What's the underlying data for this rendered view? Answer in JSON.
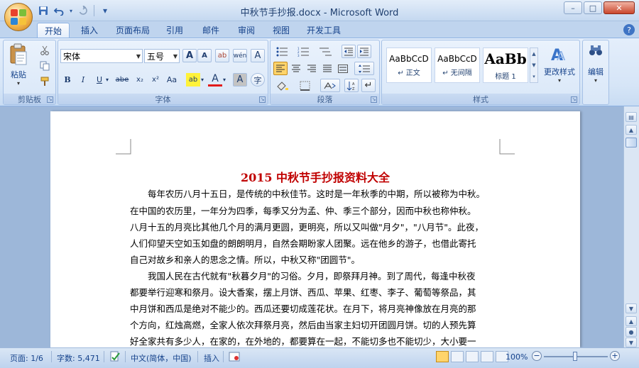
{
  "window": {
    "title": "中秋节手抄报.docx - Microsoft Word",
    "controls": {
      "minimize": "–",
      "maximize": "□",
      "close": "✕"
    }
  },
  "quick_access": {
    "save_icon": "save-icon",
    "undo_icon": "undo-icon",
    "redo_icon": "redo-icon",
    "customize": "▾"
  },
  "tabs": [
    {
      "label": "开始",
      "active": true
    },
    {
      "label": "插入"
    },
    {
      "label": "页面布局"
    },
    {
      "label": "引用"
    },
    {
      "label": "邮件"
    },
    {
      "label": "审阅"
    },
    {
      "label": "视图"
    },
    {
      "label": "开发工具"
    }
  ],
  "ribbon": {
    "clipboard": {
      "label": "剪贴板",
      "paste_label": "粘贴"
    },
    "font": {
      "label": "字体",
      "font_name": "宋体",
      "font_size": "五号",
      "bold": "B",
      "italic": "I",
      "underline": "U",
      "strikethrough": "abe",
      "subscript": "x₂",
      "superscript": "x²",
      "change_case": "Aa",
      "grow": "A",
      "shrink": "A",
      "clear": "ab",
      "phonetic": "wén",
      "border": "A",
      "highlight": "ab",
      "font_color": "A",
      "shading": "A",
      "enclosed": "字"
    },
    "paragraph": {
      "label": "段落"
    },
    "styles": {
      "label": "样式",
      "items": [
        {
          "sample": "AaBbCcD",
          "name": "↵ 正文"
        },
        {
          "sample": "AaBbCcD",
          "name": "↵ 无间隔"
        },
        {
          "sample": "AaBb",
          "name": "标题 1"
        }
      ],
      "change_styles": "更改样式"
    },
    "editing": {
      "label": "编辑"
    }
  },
  "document": {
    "title": "2015 中秋节手抄报资料大全",
    "lines": [
      "每年农历八月十五日，是传统的中秋佳节。这时是一年秋季的中期，所以被称为中秋。",
      "在中国的农历里，一年分为四季，每季又分为孟、仲、季三个部分，因而中秋也称仲秋。",
      "八月十五的月亮比其他几个月的满月更圆，更明亮，所以又叫做\"月夕\"，\"八月节\"。此夜，",
      "人们仰望天空如玉如盘的朗朗明月，自然会期盼家人团聚。远在他乡的游子，也借此寄托",
      "自己对故乡和亲人的思念之情。所以，中秋又称\"团圆节\"。",
      "我国人民在古代就有\"秋暮夕月\"的习俗。夕月，即祭拜月神。到了周代，每逢中秋夜",
      "都要举行迎寒和祭月。设大香案，摆上月饼、西瓜、苹果、红枣、李子、葡萄等祭品，其",
      "中月饼和西瓜是绝对不能少的。西瓜还要切成莲花状。在月下，将月亮神像放在月亮的那",
      "个方向，红烛高燃，全家人依次拜祭月亮，然后由当家主妇切开团圆月饼。切的人预先算",
      "好全家共有多少人，在家的，在外地的，都要算在一起，不能切多也不能切少，大小要一"
    ]
  },
  "statusbar": {
    "page": "页面: 1/6",
    "words": "字数: 5,471",
    "language": "中文(简体，中国)",
    "mode": "插入",
    "zoom": "100%",
    "zoom_minus": "−",
    "zoom_plus": "+"
  }
}
